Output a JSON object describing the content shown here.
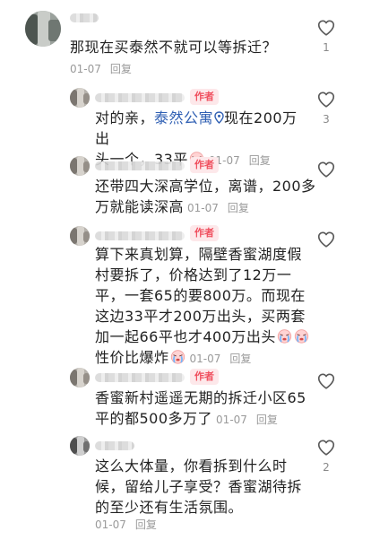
{
  "comments": [
    {
      "text": "那现在买泰然不就可以等拆迁？",
      "date": "01-07",
      "reply": "回复",
      "likes": "1"
    },
    {
      "author_badge": "作者",
      "text_a": "对的亲，",
      "link": "泰然公寓",
      "text_b": "现在200万出",
      "text_c": "头一个，33平",
      "date": "01-07",
      "reply": "回复",
      "likes": "3"
    },
    {
      "author_badge": "作者",
      "line1": "还带四大深高学位，离谱，200多",
      "line2": "万就能读深高",
      "date": "01-07",
      "reply": "回复"
    },
    {
      "author_badge": "作者",
      "line1": "算下来真划算，隔壁香蜜湖度假",
      "line2": "村要拆了，价格达到了12万一",
      "line3": "平，一套65的要800万。而现在",
      "line4": "这边33平才200万出头，买两套",
      "line5": "加一起66平也才400万出头",
      "line6": "性价比爆炸",
      "date": "01-07",
      "reply": "回复"
    },
    {
      "author_badge": "作者",
      "line1": "香蜜新村遥遥无期的拆迁小区65",
      "line2": "平的都500多万了",
      "date": "01-07",
      "reply": "回复"
    },
    {
      "line1": "这么大体量，你看拆到什么时",
      "line2": "候，留给儿子享受？香蜜湖待拆",
      "line3": "的至少还有生活氛围。",
      "date": "01-07",
      "reply": "回复",
      "likes": "2"
    }
  ],
  "icons": {
    "like": "heart-outline-icon",
    "emoji": "crying-face-emoji",
    "link_marker": "location-pin-icon"
  },
  "colors": {
    "author_badge_bg": "#fde8ea",
    "author_badge_text": "#f0505f",
    "link": "#2f5fb3",
    "meta": "#9a9a9a"
  }
}
